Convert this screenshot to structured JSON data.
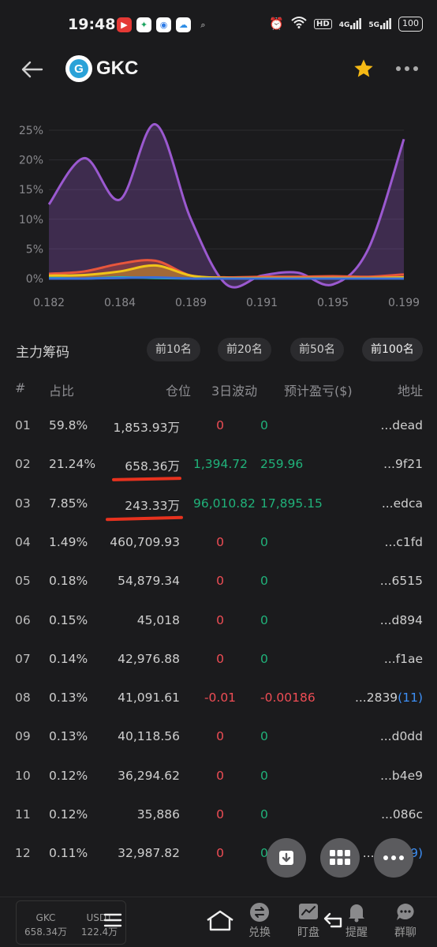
{
  "status_bar": {
    "time": "19:48",
    "hd": "HD",
    "net1": "4G",
    "net2": "5G",
    "battery": "100"
  },
  "header": {
    "back_icon": "arrow-left-icon",
    "token_logo_letter": "G",
    "token_name": "GKC",
    "favorite_icon": "star-icon",
    "more_icon": "more-dots-icon",
    "star_color": "#f5b915"
  },
  "chart_data": {
    "type": "area",
    "x_tick_labels": [
      "0.182",
      "0.184",
      "0.189",
      "0.191",
      "0.195",
      "0.199"
    ],
    "y_tick_labels": [
      "25%",
      "20%",
      "15%",
      "10%",
      "5%",
      "0%"
    ],
    "ylim": [
      -2,
      27
    ],
    "x": [
      0,
      1,
      2,
      3,
      4,
      5,
      6,
      7,
      8,
      9,
      10
    ],
    "grid": true,
    "series": [
      {
        "color": "#9b59d0",
        "values": [
          12.5,
          20.3,
          13.3,
          26,
          10,
          -1,
          0.5,
          1,
          -1,
          5,
          23.5
        ]
      },
      {
        "color": "#e8563c",
        "values": [
          0.8,
          1.2,
          2.5,
          3.0,
          0.5,
          0.2,
          0.3,
          0.3,
          0.4,
          0.3,
          0.7
        ]
      },
      {
        "color": "#f0c419",
        "values": [
          0.5,
          0.6,
          1.2,
          2.2,
          0.5,
          0.1,
          0.1,
          0.1,
          0.1,
          0.1,
          0.2
        ]
      },
      {
        "color": "#1dc7a8",
        "values": [
          0.1,
          0.0,
          0.2,
          0.1,
          0.0,
          0.0,
          0.0,
          0.0,
          0.0,
          0.0,
          0.0
        ]
      },
      {
        "color": "#3b6fd8",
        "values": [
          0.0,
          0.0,
          0.1,
          0.2,
          0.0,
          0.0,
          0.0,
          0.0,
          0.0,
          0.0,
          0.0
        ]
      }
    ]
  },
  "holders": {
    "section_title": "主力筹码",
    "filters": [
      "前10名",
      "前20名",
      "前50名",
      "前100名"
    ],
    "active_filter": "前100名",
    "columns": {
      "idx": "#",
      "pct": "占比",
      "pos": "仓位",
      "vol": "3日波动",
      "pnl": "预计盈亏($)",
      "addr": "地址"
    },
    "rows": [
      {
        "idx": "01",
        "pct": "59.8%",
        "pos": "1,853.93万",
        "vol": "0",
        "pnl": "0",
        "addr": "...dead",
        "addr_count": ""
      },
      {
        "idx": "02",
        "pct": "21.24%",
        "pos": "658.36万",
        "vol": "1,394.72",
        "pnl": "259.96",
        "addr": "...9f21",
        "addr_count": ""
      },
      {
        "idx": "03",
        "pct": "7.85%",
        "pos": "243.33万",
        "vol": "96,010.82",
        "pnl": "17,895.15",
        "addr": "...edca",
        "addr_count": ""
      },
      {
        "idx": "04",
        "pct": "1.49%",
        "pos": "460,709.93",
        "vol": "0",
        "pnl": "0",
        "addr": "...c1fd",
        "addr_count": ""
      },
      {
        "idx": "05",
        "pct": "0.18%",
        "pos": "54,879.34",
        "vol": "0",
        "pnl": "0",
        "addr": "...6515",
        "addr_count": ""
      },
      {
        "idx": "06",
        "pct": "0.15%",
        "pos": "45,018",
        "vol": "0",
        "pnl": "0",
        "addr": "...d894",
        "addr_count": ""
      },
      {
        "idx": "07",
        "pct": "0.14%",
        "pos": "42,976.88",
        "vol": "0",
        "pnl": "0",
        "addr": "...f1ae",
        "addr_count": ""
      },
      {
        "idx": "08",
        "pct": "0.13%",
        "pos": "41,091.61",
        "vol": "-0.01",
        "pnl": "-0.00186",
        "addr": "...2839",
        "addr_count": "(11)"
      },
      {
        "idx": "09",
        "pct": "0.13%",
        "pos": "40,118.56",
        "vol": "0",
        "pnl": "0",
        "addr": "...d0dd",
        "addr_count": ""
      },
      {
        "idx": "10",
        "pct": "0.12%",
        "pos": "36,294.62",
        "vol": "0",
        "pnl": "0",
        "addr": "...b4e9",
        "addr_count": ""
      },
      {
        "idx": "11",
        "pct": "0.12%",
        "pos": "35,886",
        "vol": "0",
        "pnl": "0",
        "addr": "...086c",
        "addr_count": ""
      },
      {
        "idx": "12",
        "pct": "0.11%",
        "pos": "32,987.82",
        "vol": "0",
        "pnl": "0",
        "addr": "...6603",
        "addr_count": "(9)"
      }
    ]
  },
  "floating_buttons": [
    "download-icon",
    "grid-icon",
    "more-dots-icon"
  ],
  "bottom_bar": {
    "holding": [
      {
        "symbol": "GKC",
        "amount": "658.34万"
      },
      {
        "symbol": "USDT",
        "amount": "122.4万"
      }
    ],
    "nav": [
      {
        "label": "兑换",
        "icon": "swap-icon"
      },
      {
        "label": "盯盘",
        "icon": "chart-line-icon"
      },
      {
        "label": "提醒",
        "icon": "bell-icon"
      },
      {
        "label": "群聊",
        "icon": "chat-icon"
      }
    ]
  }
}
